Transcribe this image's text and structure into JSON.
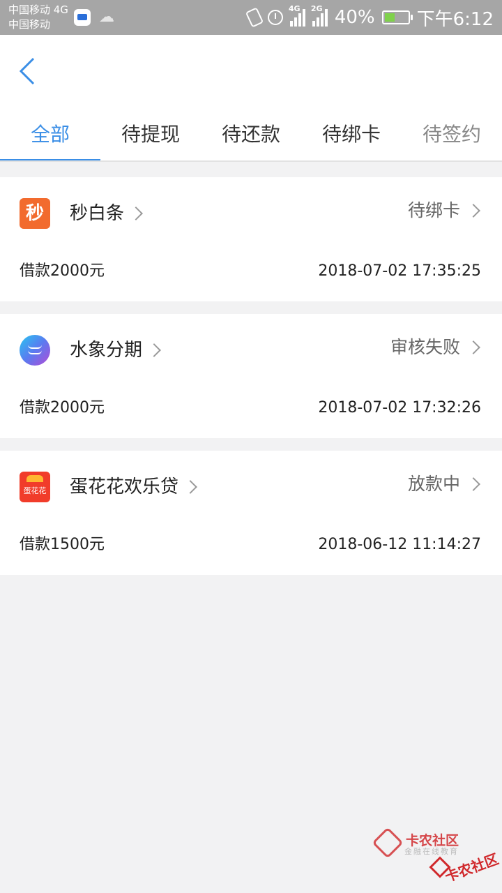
{
  "status_bar": {
    "carrier_line1": "中国移动 4G",
    "carrier_line2": "中国移动",
    "net1": "4G",
    "net2": "2G",
    "battery": "40%",
    "time": "下午6:12"
  },
  "header": {
    "back_icon": "chevron-left-icon"
  },
  "tabs": [
    {
      "label": "全部",
      "active": true
    },
    {
      "label": "待提现",
      "active": false
    },
    {
      "label": "待还款",
      "active": false
    },
    {
      "label": "待绑卡",
      "active": false
    },
    {
      "label": "待签约",
      "active": false
    }
  ],
  "loans": [
    {
      "name": "秒白条",
      "logo_text": "秒",
      "status": "待绑卡",
      "amount": "借款2000元",
      "time": "2018-07-02 17:35:25"
    },
    {
      "name": "水象分期",
      "logo_text": "",
      "status": "审核失败",
      "amount": "借款2000元",
      "time": "2018-07-02 17:32:26"
    },
    {
      "name": "蛋花花欢乐贷",
      "logo_text": "蛋花花",
      "status": "放款中",
      "amount": "借款1500元",
      "time": "2018-06-12 11:14:27"
    }
  ],
  "watermark": {
    "title": "卡农社区",
    "subtitle": "金融在线教育",
    "title2": "卡农社区"
  },
  "colors": {
    "accent": "#3a8ee6",
    "status_bar": "#a6a6a6",
    "background": "#f2f2f3"
  }
}
